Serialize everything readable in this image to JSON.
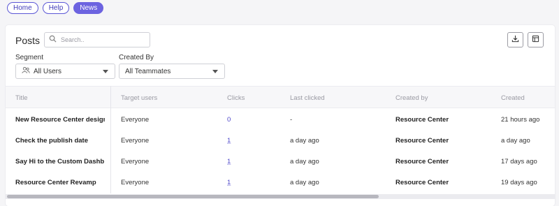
{
  "nav": {
    "tabs": [
      {
        "label": "Home"
      },
      {
        "label": "Help"
      },
      {
        "label": "News"
      }
    ],
    "active": "News"
  },
  "posts": {
    "title": "Posts",
    "search_placeholder": "Search..",
    "download_icon": "download-icon",
    "columns_icon": "columns-icon",
    "filters": {
      "segment_label": "Segment",
      "segment_value": "All Users",
      "created_by_label": "Created By",
      "created_by_value": "All Teammates"
    },
    "table": {
      "headers": [
        "Title",
        "Target users",
        "Clicks",
        "Last clicked",
        "Created by",
        "Created"
      ],
      "rows": [
        {
          "title": "New Resource Center design!",
          "target": "Everyone",
          "clicks": "0",
          "last_clicked": "-",
          "created_by": "Resource Center",
          "created": "21 hours ago"
        },
        {
          "title": "Check the publish date",
          "target": "Everyone",
          "clicks": "1",
          "last_clicked": "a day ago",
          "created_by": "Resource Center",
          "created": "a day ago"
        },
        {
          "title": "Say Hi to the Custom Dashb…",
          "target": "Everyone",
          "clicks": "1",
          "last_clicked": "a day ago",
          "created_by": "Resource Center",
          "created": "17 days ago"
        },
        {
          "title": "Resource Center Revamp",
          "target": "Everyone",
          "clicks": "1",
          "last_clicked": "a day ago",
          "created_by": "Resource Center",
          "created": "19 days ago"
        }
      ]
    }
  },
  "colors": {
    "accent": "#6c63e0",
    "link": "#4b44c9"
  }
}
